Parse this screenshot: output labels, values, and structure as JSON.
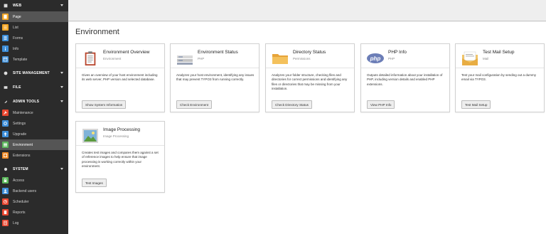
{
  "sidebar": {
    "sections": [
      {
        "title": "WEB",
        "icon": "globe-icon",
        "modules": [
          {
            "label": "Page",
            "icon": "page-icon",
            "color": "#f5a623",
            "active": true
          },
          {
            "label": "List",
            "icon": "list-icon",
            "color": "#f5a623"
          },
          {
            "label": "Forms",
            "icon": "forms-icon",
            "color": "#3d8ed9"
          },
          {
            "label": "Info",
            "icon": "info-icon",
            "color": "#3d8ed9"
          },
          {
            "label": "Template",
            "icon": "template-icon",
            "color": "#3d8ed9"
          }
        ]
      },
      {
        "title": "SITE MANAGEMENT",
        "icon": "site-management-icon",
        "modules": []
      },
      {
        "title": "FILE",
        "icon": "file-icon",
        "modules": []
      },
      {
        "title": "ADMIN TOOLS",
        "icon": "rocket-icon",
        "modules": [
          {
            "label": "Maintenance",
            "icon": "wrench-icon",
            "color": "#e8462f"
          },
          {
            "label": "Settings",
            "icon": "settings-icon",
            "color": "#3d8ed9"
          },
          {
            "label": "Upgrade",
            "icon": "upgrade-icon",
            "color": "#3d8ed9"
          },
          {
            "label": "Environment",
            "icon": "environment-icon",
            "color": "#5cb85c",
            "active": true
          },
          {
            "label": "Extensions",
            "icon": "extensions-icon",
            "color": "#f08a24"
          }
        ]
      },
      {
        "title": "SYSTEM",
        "icon": "gear-icon",
        "modules": [
          {
            "label": "Access",
            "icon": "lock-icon",
            "color": "#5cb85c"
          },
          {
            "label": "Backend users",
            "icon": "user-icon",
            "color": "#3d8ed9"
          },
          {
            "label": "Scheduler",
            "icon": "scheduler-icon",
            "color": "#e8462f"
          },
          {
            "label": "Reports",
            "icon": "reports-icon",
            "color": "#e8462f"
          },
          {
            "label": "Log",
            "icon": "log-icon",
            "color": "#e8462f"
          }
        ]
      }
    ]
  },
  "main": {
    "title": "Environment",
    "cards": [
      {
        "title": "Environment Overview",
        "subtitle": "Environment",
        "description": "Gives an overview of your host environment including its web server, PHP version and selected database.",
        "button": "Show System Information",
        "icon": "clipboard-icon"
      },
      {
        "title": "Environment Status",
        "subtitle": "PHP",
        "description": "Analyzes your host environment, identifying any issues that may prevent TYPO3 from running correctly.",
        "button": "Check Environment",
        "icon": "server-icon"
      },
      {
        "title": "Directory Status",
        "subtitle": "Permissions",
        "description": "Analyzes your folder structure, checking files and directories for correct permissions and identifying any files or directories that may be missing from your installation.",
        "button": "Check Directory Status",
        "icon": "folder-icon"
      },
      {
        "title": "PHP Info",
        "subtitle": "PHP",
        "description": "Outputs detailed information about your installation of PHP, including version details and enabled PHP extensions.",
        "button": "View PHP Info",
        "icon": "php-icon",
        "logo_text": "php"
      },
      {
        "title": "Test Mail Setup",
        "subtitle": "Mail",
        "description": "Test your mail configuration by sending out a dummy email via TYPO3.",
        "button": "Test Mail Setup",
        "icon": "envelope-icon"
      },
      {
        "title": "Image Processing",
        "subtitle": "Image Processing",
        "description": "Creates test images and compares them against a set of reference images to help ensure that image processing is working correctly within your environment.",
        "button": "Test Images",
        "icon": "image-icon"
      }
    ]
  },
  "colors": {
    "sidebar_bg": "#2b2b2b",
    "active_bg": "#555555",
    "php_blue": "#6c7eb7"
  }
}
